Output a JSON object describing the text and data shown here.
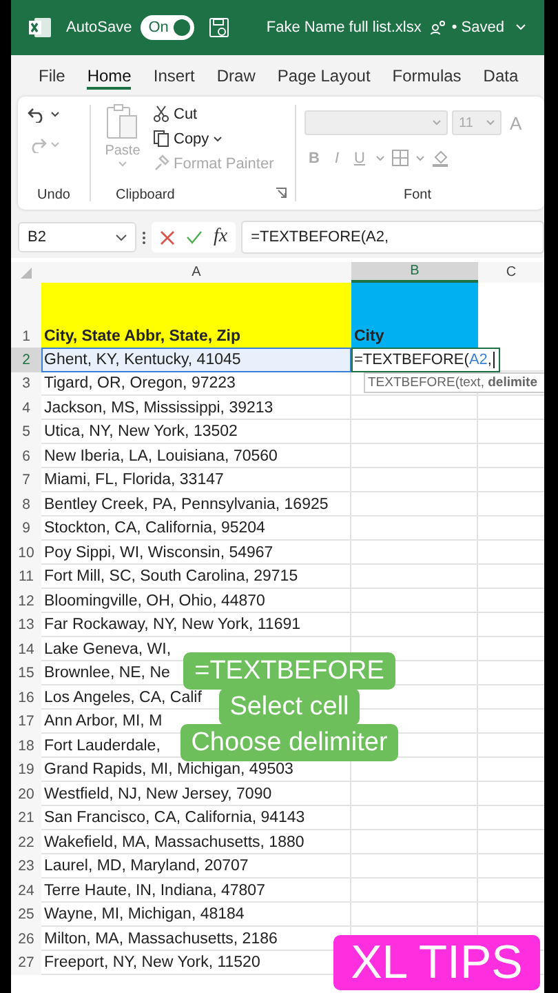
{
  "title_bar": {
    "autosave_label": "AutoSave",
    "autosave_toggle": {
      "label": "On",
      "on": true
    },
    "file_name": "Fake Name full list.xlsx",
    "save_status": "• Saved"
  },
  "tabs": [
    {
      "label": "File",
      "selected": false
    },
    {
      "label": "Home",
      "selected": true
    },
    {
      "label": "Insert",
      "selected": false
    },
    {
      "label": "Draw",
      "selected": false
    },
    {
      "label": "Page Layout",
      "selected": false
    },
    {
      "label": "Formulas",
      "selected": false
    },
    {
      "label": "Data",
      "selected": false
    }
  ],
  "ribbon": {
    "undo_group": {
      "label": "Undo"
    },
    "clipboard": {
      "label": "Clipboard",
      "paste": {
        "label": "Paste",
        "disabled": true
      },
      "items": [
        {
          "kind": "cut",
          "label": "Cut",
          "disabled": false
        },
        {
          "kind": "copy",
          "label": "Copy",
          "disabled": false
        },
        {
          "kind": "painter",
          "label": "Format Painter",
          "disabled": true
        }
      ]
    },
    "font": {
      "label": "Font",
      "size": "11",
      "grow_font": "A",
      "style_buttons": [
        "B",
        "I",
        "U"
      ],
      "disabled": true
    }
  },
  "formula_bar": {
    "name_box": "B2",
    "function_label": "fx",
    "formula": "=TEXTBEFORE(A2,"
  },
  "sheet": {
    "columns": [
      {
        "label": "A",
        "selected": false
      },
      {
        "label": "B",
        "selected": true
      },
      {
        "label": "C",
        "selected": false
      }
    ],
    "header_row": {
      "number": "1",
      "cells": [
        {
          "text": "City, State Abbr, State, Zip",
          "color": "#ffff00"
        },
        {
          "text": "City",
          "color": "#00b0f0"
        }
      ]
    },
    "editing_cell": {
      "parts": [
        {
          "text": "=TEXTBEFORE(",
          "ref": false
        },
        {
          "text": "A2",
          "ref": true
        },
        {
          "text": ",",
          "ref": false
        }
      ],
      "tooltip": "TEXTBEFORE(text, **delimite**"
    },
    "rows": [
      {
        "number": "2",
        "selected": true,
        "text": "Ghent, KY, Kentucky, 41045"
      },
      {
        "number": "3",
        "selected": false,
        "text": "Tigard, OR, Oregon, 97223"
      },
      {
        "number": "4",
        "selected": false,
        "text": "Jackson, MS, Mississippi, 39213"
      },
      {
        "number": "5",
        "selected": false,
        "text": "Utica, NY, New York, 13502"
      },
      {
        "number": "6",
        "selected": false,
        "text": "New Iberia, LA, Louisiana, 70560"
      },
      {
        "number": "7",
        "selected": false,
        "text": "Miami, FL, Florida, 33147"
      },
      {
        "number": "8",
        "selected": false,
        "text": "Bentley Creek, PA, Pennsylvania, 16925"
      },
      {
        "number": "9",
        "selected": false,
        "text": "Stockton, CA, California, 95204"
      },
      {
        "number": "10",
        "selected": false,
        "text": "Poy Sippi, WI, Wisconsin, 54967"
      },
      {
        "number": "11",
        "selected": false,
        "text": "Fort Mill, SC, South Carolina, 29715"
      },
      {
        "number": "12",
        "selected": false,
        "text": "Bloomingville, OH, Ohio, 44870"
      },
      {
        "number": "13",
        "selected": false,
        "text": "Far Rockaway, NY, New York, 11691"
      },
      {
        "number": "14",
        "selected": false,
        "text": "Lake Geneva, WI,"
      },
      {
        "number": "15",
        "selected": false,
        "text": "Brownlee, NE, Ne"
      },
      {
        "number": "16",
        "selected": false,
        "text": "Los Angeles, CA, Calif"
      },
      {
        "number": "17",
        "selected": false,
        "text": "Ann Arbor, MI, M"
      },
      {
        "number": "18",
        "selected": false,
        "text": "Fort Lauderdale,"
      },
      {
        "number": "19",
        "selected": false,
        "text": "Grand Rapids, MI, Michigan, 49503"
      },
      {
        "number": "20",
        "selected": false,
        "text": "Westfield, NJ, New Jersey, 7090"
      },
      {
        "number": "21",
        "selected": false,
        "text": "San Francisco, CA, California, 94143"
      },
      {
        "number": "22",
        "selected": false,
        "text": "Wakefield, MA, Massachusetts, 1880"
      },
      {
        "number": "23",
        "selected": false,
        "text": "Laurel, MD, Maryland, 20707"
      },
      {
        "number": "24",
        "selected": false,
        "text": "Terre Haute, IN, Indiana, 47807"
      },
      {
        "number": "25",
        "selected": false,
        "text": "Wayne, MI, Michigan, 48184"
      },
      {
        "number": "26",
        "selected": false,
        "text": "Milton, MA, Massachusetts, 2186"
      },
      {
        "number": "27",
        "selected": false,
        "text": "Freeport, NY, New York, 11520"
      }
    ]
  },
  "overlay": {
    "captions": [
      "=TEXTBEFORE",
      "Select cell",
      "Choose delimiter"
    ],
    "badge": "XL TIPS"
  }
}
